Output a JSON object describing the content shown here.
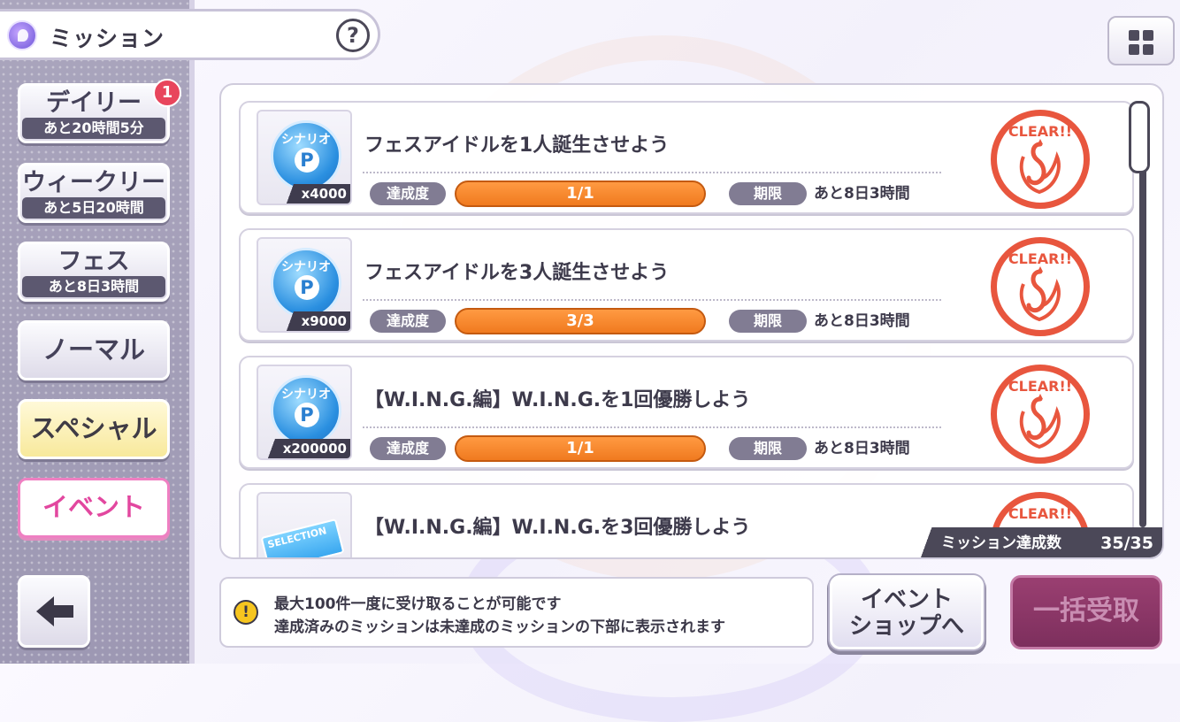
{
  "header": {
    "title": "ミッション",
    "help": "?"
  },
  "tabs": [
    {
      "label": "デイリー",
      "sub": "あと20時間5分",
      "badge": "1"
    },
    {
      "label": "ウィークリー",
      "sub": "あと5日20時間"
    },
    {
      "label": "フェス",
      "sub": "あと8日3時間"
    },
    {
      "label": "ノーマル"
    },
    {
      "label": "スペシャル"
    },
    {
      "label": "イベント"
    }
  ],
  "missions": [
    {
      "reward_name": "シナリオ",
      "reward_symbol": "P",
      "reward_qty": "x4000",
      "title": "フェスアイドルを1人誕生させよう",
      "progress_label": "達成度",
      "progress": "1/1",
      "progress_fraction": 1.0,
      "deadline_label": "期限",
      "deadline": "あと8日3時間",
      "stamp": "CLEAR!!"
    },
    {
      "reward_name": "シナリオ",
      "reward_symbol": "P",
      "reward_qty": "x9000",
      "title": "フェスアイドルを3人誕生させよう",
      "progress_label": "達成度",
      "progress": "3/3",
      "progress_fraction": 1.0,
      "deadline_label": "期限",
      "deadline": "あと8日3時間",
      "stamp": "CLEAR!!"
    },
    {
      "reward_name": "シナリオ",
      "reward_symbol": "P",
      "reward_qty": "x200000",
      "title": "【W.I.N.G.編】W.I.N.G.を1回優勝しよう",
      "progress_label": "達成度",
      "progress": "1/1",
      "progress_fraction": 1.0,
      "deadline_label": "期限",
      "deadline": "あと8日3時間",
      "stamp": "CLEAR!!"
    },
    {
      "reward_name": "SELECTION",
      "title": "【W.I.N.G.編】W.I.N.G.を3回優勝しよう",
      "stamp": "CLEAR!!"
    }
  ],
  "mission_count": {
    "label": "ミッション達成数",
    "value": "35/35"
  },
  "notice": {
    "line1": "最大100件一度に受け取ることが可能です",
    "line2": "達成済みのミッションは未達成のミッションの下部に表示されます"
  },
  "buttons": {
    "shop_line1": "イベント",
    "shop_line2": "ショップへ",
    "collect_all": "一括受取"
  },
  "colors": {
    "progress": "#f07a1f",
    "stamp": "#e8563e",
    "event_tab": "#e2479f",
    "badge": "#e8455c"
  }
}
